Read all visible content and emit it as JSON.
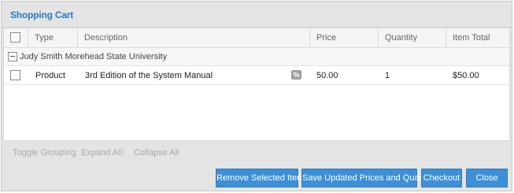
{
  "dialog": {
    "title": "Shopping Cart"
  },
  "grid": {
    "columns": {
      "type": "Type",
      "description": "Description",
      "price": "Price",
      "quantity": "Quantity",
      "item_total": "Item Total"
    },
    "group": {
      "label": "Judy Smith Morehead State University"
    },
    "rows": [
      {
        "type": "Product",
        "description": "3rd Edition of the System Manual",
        "discount_icon": "percent-icon",
        "discount_glyph": "%",
        "price": "50.00",
        "quantity": "1",
        "item_total": "$50.00"
      }
    ]
  },
  "toolbar": {
    "toggle_grouping": "Toggle Grouping",
    "expand_all": "Expand All",
    "collapse_all": "Collapse All"
  },
  "buttons": {
    "remove_selected": "Remove Selected Items",
    "save_updated": "Save Updated Prices and Quantities",
    "checkout": "Checkout",
    "close": "Close"
  },
  "colors": {
    "accent": "#2a7cc4",
    "button": "#3d8fd6",
    "disabled_link": "#a8a8a8"
  }
}
